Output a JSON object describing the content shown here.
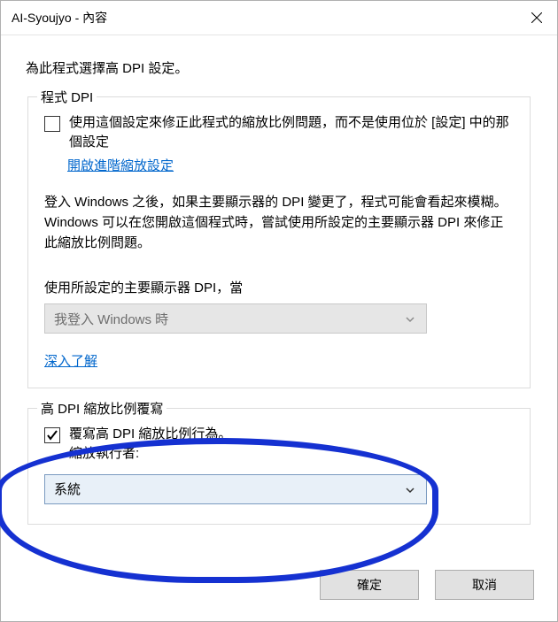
{
  "window": {
    "title": "AI-Syoujyo - 內容"
  },
  "intro": "為此程式選擇高 DPI 設定。",
  "group1": {
    "legend": "程式 DPI",
    "checkbox_label": "使用這個設定來修正此程式的縮放比例問題，而不是使用位於 [設定] 中的那個設定",
    "link_advanced": "開啟進階縮放設定",
    "paragraph": "登入 Windows 之後，如果主要顯示器的 DPI 變更了，程式可能會看起來模糊。Windows 可以在您開啟這個程式時，嘗試使用所設定的主要顯示器 DPI 來修正此縮放比例問題。",
    "select_label": "使用所設定的主要顯示器 DPI，當",
    "select_value": "我登入 Windows 時",
    "link_learn": "深入了解"
  },
  "group2": {
    "legend": "高 DPI 縮放比例覆寫",
    "checkbox_line1": "覆寫高 DPI 縮放比例行為。",
    "checkbox_line2": "縮放執行者:",
    "select_value": "系統"
  },
  "buttons": {
    "ok": "確定",
    "cancel": "取消"
  }
}
